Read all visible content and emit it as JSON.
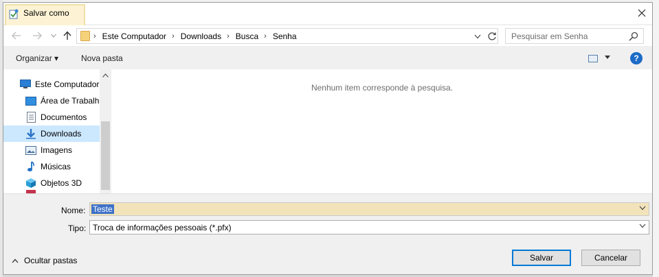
{
  "window": {
    "title": "Salvar como",
    "close": "✕"
  },
  "navigation": {
    "back_icon": "back-arrow-icon",
    "forward_icon": "forward-arrow-icon",
    "up_icon": "up-arrow-icon",
    "breadcrumb": [
      "Este Computador",
      "Downloads",
      "Busca",
      "Senha"
    ],
    "search_placeholder": "Pesquisar em Senha"
  },
  "toolbar": {
    "organize_label": "Organizar ▾",
    "new_folder_label": "Nova pasta",
    "help_label": "?"
  },
  "sidebar": {
    "items": [
      {
        "label": "Este Computador",
        "icon": "computer-icon"
      },
      {
        "label": "Área de Trabalho",
        "icon": "desktop-icon"
      },
      {
        "label": "Documentos",
        "icon": "documents-icon"
      },
      {
        "label": "Downloads",
        "icon": "downloads-icon"
      },
      {
        "label": "Imagens",
        "icon": "images-icon"
      },
      {
        "label": "Músicas",
        "icon": "music-icon"
      },
      {
        "label": "Objetos 3D",
        "icon": "3d-objects-icon"
      }
    ]
  },
  "content": {
    "empty_message": "Nenhum item corresponde à pesquisa."
  },
  "form": {
    "name_label": "Nome:",
    "name_value": "Teste",
    "type_label": "Tipo:",
    "type_value": "Troca de informações pessoais (*.pfx)"
  },
  "footer": {
    "hide_folders_label": "Ocultar pastas",
    "save_label": "Salvar",
    "cancel_label": "Cancelar"
  },
  "colors": {
    "accent": "#0078d7",
    "selection": "#cce8ff",
    "title_highlight": "#fdf3d4",
    "name_field": "#f2e3bb"
  }
}
